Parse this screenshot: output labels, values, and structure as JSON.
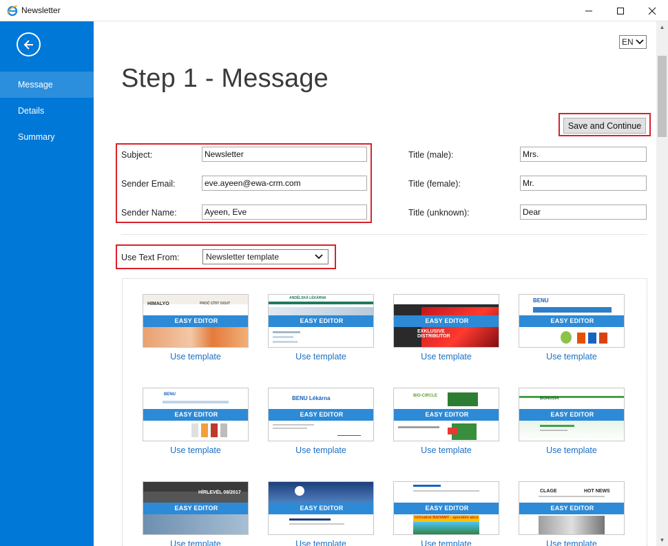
{
  "window": {
    "title": "Newsletter"
  },
  "sidebar": {
    "items": [
      {
        "label": "Message",
        "active": true
      },
      {
        "label": "Details",
        "active": false
      },
      {
        "label": "Summary",
        "active": false
      }
    ]
  },
  "language": {
    "value": "EN"
  },
  "page": {
    "title": "Step 1 - Message"
  },
  "actions": {
    "save_continue": "Save and Continue"
  },
  "form": {
    "subject_label": "Subject:",
    "subject_value": "Newsletter",
    "sender_email_label": "Sender Email:",
    "sender_email_value": "eve.ayeen@ewa-crm.com",
    "sender_name_label": "Sender Name:",
    "sender_name_value": "Ayeen, Eve",
    "title_male_label": "Title (male):",
    "title_male_value": "Mrs.",
    "title_female_label": "Title (female):",
    "title_female_value": "Mr.",
    "title_unknown_label": "Title (unknown):",
    "title_unknown_value": "Dear"
  },
  "text_source": {
    "label": "Use Text From:",
    "selected": "Newsletter template"
  },
  "templates": {
    "band_label": "EASY EDITOR",
    "link_label": "Use template",
    "items": [
      {
        "logo": "HIMALYO",
        "extra": "PROČ CÍTIT OOUT"
      },
      {
        "logo": "ANDĚLSKÁ LÉKÁRNA",
        "extra": ""
      },
      {
        "logo": "",
        "extra": "EXKLUSIVE DISTRIBUTOR"
      },
      {
        "logo": "BENU",
        "extra": ""
      },
      {
        "logo": "BENU",
        "extra": ""
      },
      {
        "logo": "BENU Lékárna",
        "extra": ""
      },
      {
        "logo": "BIO-CIRCLE",
        "extra": ""
      },
      {
        "logo": "BONUSIA",
        "extra": ""
      },
      {
        "logo": "",
        "extra": "HÍRLEVÉL 08/2017"
      },
      {
        "logo": "",
        "extra": ""
      },
      {
        "logo": "",
        "extra": "Uchvátné BAHAMY - speciální akce"
      },
      {
        "logo": "CLAGE",
        "extra": "HOT NEWS"
      }
    ]
  },
  "colors": {
    "accent": "#0078d7",
    "highlight": "#d8202a",
    "link": "#1a6fc4",
    "band": "#2d8ad7"
  }
}
